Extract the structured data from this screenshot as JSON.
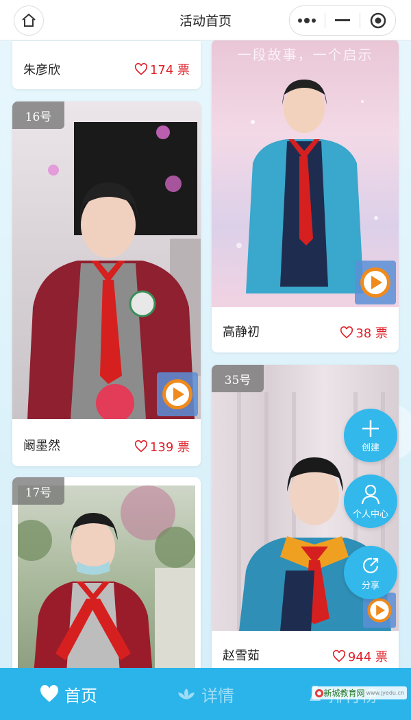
{
  "header": {
    "title": "活动首页",
    "home_icon": "home-icon",
    "more_icon": "more-dots-icon",
    "minimize_icon": "minimize-icon",
    "close_icon": "target-close-icon"
  },
  "cards": {
    "top_left": {
      "name": "朱彦欣",
      "votes": "174 票"
    },
    "top_right": {
      "watermark": "一段故事，一个启示",
      "name": "高静初",
      "votes": "38 票"
    },
    "c16": {
      "tag": "16号",
      "name": "阚墨然",
      "votes": "139 票"
    },
    "c35": {
      "tag": "35号",
      "name": "赵雪茹",
      "votes": "944 票"
    },
    "c17": {
      "tag": "17号"
    }
  },
  "fabs": {
    "create": "创建",
    "profile": "个人中心",
    "share": "分享"
  },
  "nav": {
    "home": "首页",
    "details": "详情",
    "ranking": "排行榜"
  },
  "brand": {
    "name": "新城教育网",
    "sub": "www.jyedu.cn"
  },
  "colors": {
    "accent": "#2bb4ea",
    "vote_red": "#e0202a"
  }
}
